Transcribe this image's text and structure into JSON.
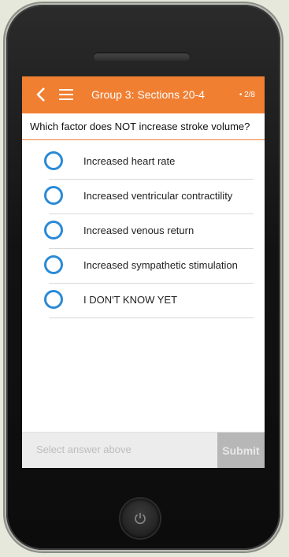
{
  "header": {
    "title": "Group 3: Sections 20-4",
    "progress": "• 2/8",
    "icons": [
      "chevron-left-icon",
      "hamburger-menu-icon"
    ]
  },
  "question": {
    "text": "Which factor does NOT increase stroke volume?"
  },
  "answers": [
    {
      "label": "Increased heart rate"
    },
    {
      "label": "Increased ventricular contractility"
    },
    {
      "label": "Increased venous return"
    },
    {
      "label": "Increased sympathetic stimulation"
    },
    {
      "label": "I DON'T KNOW YET"
    }
  ],
  "footer": {
    "hint": "Select answer above",
    "submit_label": "Submit"
  },
  "colors": {
    "accent": "#f07f32",
    "radio": "#2a8ad6",
    "submit_disabled": "#b7b7b7"
  }
}
